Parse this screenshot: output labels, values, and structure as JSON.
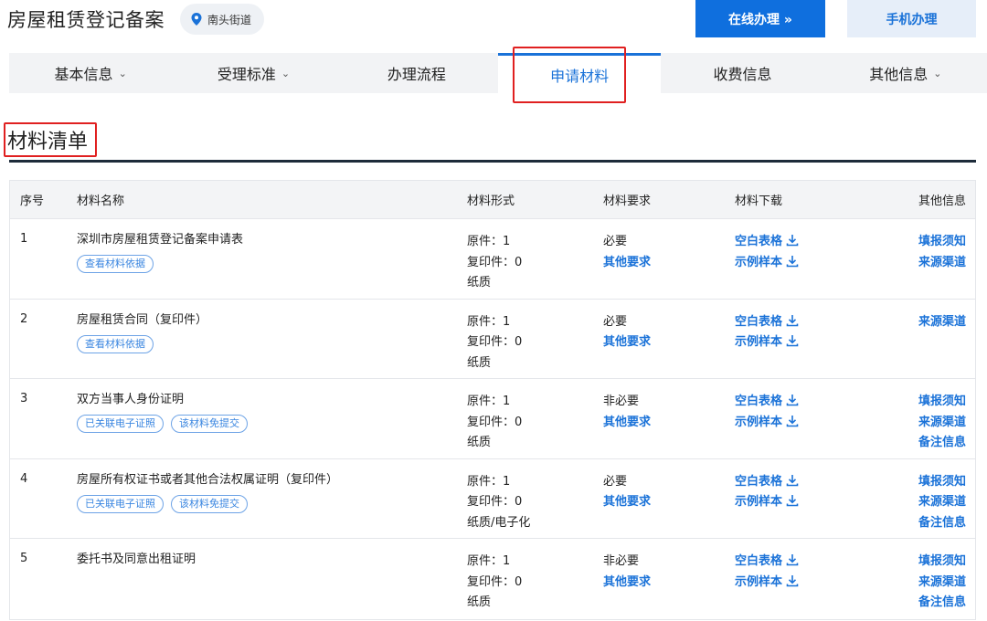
{
  "header": {
    "title": "房屋租赁登记备案",
    "location": "南头街道",
    "online_btn": "在线办理 »",
    "mobile_btn": "手机办理"
  },
  "tabs": [
    {
      "label": "基本信息",
      "dropdown": true
    },
    {
      "label": "受理标准",
      "dropdown": true
    },
    {
      "label": "办理流程",
      "dropdown": false
    },
    {
      "label": "申请材料",
      "dropdown": false,
      "active": true
    },
    {
      "label": "收费信息",
      "dropdown": false
    },
    {
      "label": "其他信息",
      "dropdown": true
    }
  ],
  "section": {
    "title": "材料清单"
  },
  "table": {
    "headers": {
      "idx": "序号",
      "name": "材料名称",
      "form": "材料形式",
      "req": "材料要求",
      "download": "材料下载",
      "other": "其他信息"
    },
    "rows": [
      {
        "idx": "1",
        "name": "深圳市房屋租赁登记备案申请表",
        "tags": [
          "查看材料依据"
        ],
        "form": [
          "原件：1",
          "复印件：0",
          "纸质"
        ],
        "req": "必要",
        "req_link": "其他要求",
        "downloads": [
          "空白表格",
          "示例样本"
        ],
        "other": [
          "填报须知",
          "来源渠道"
        ]
      },
      {
        "idx": "2",
        "name": "房屋租赁合同（复印件）",
        "tags": [
          "查看材料依据"
        ],
        "form": [
          "原件：1",
          "复印件：0",
          "纸质"
        ],
        "req": "必要",
        "req_link": "其他要求",
        "downloads": [
          "空白表格",
          "示例样本"
        ],
        "other": [
          "来源渠道"
        ]
      },
      {
        "idx": "3",
        "name": "双方当事人身份证明",
        "tags": [
          "已关联电子证照",
          "该材料免提交"
        ],
        "form": [
          "原件：1",
          "复印件：0",
          "纸质"
        ],
        "req": "非必要",
        "req_link": "其他要求",
        "downloads": [
          "空白表格",
          "示例样本"
        ],
        "other": [
          "填报须知",
          "来源渠道",
          "备注信息"
        ]
      },
      {
        "idx": "4",
        "name": "房屋所有权证书或者其他合法权属证明（复印件）",
        "tags": [
          "已关联电子证照",
          "该材料免提交"
        ],
        "form": [
          "原件：1",
          "复印件：0",
          "纸质/电子化"
        ],
        "req": "必要",
        "req_link": "其他要求",
        "downloads": [
          "空白表格",
          "示例样本"
        ],
        "other": [
          "填报须知",
          "来源渠道",
          "备注信息"
        ]
      },
      {
        "idx": "5",
        "name": "委托书及同意出租证明",
        "tags": [],
        "form": [
          "原件：1",
          "复印件：0",
          "纸质"
        ],
        "req": "非必要",
        "req_link": "其他要求",
        "downloads": [
          "空白表格",
          "示例样本"
        ],
        "other": [
          "填报须知",
          "来源渠道",
          "备注信息"
        ]
      }
    ]
  },
  "colors": {
    "accent": "#1a72d8",
    "highlight": "#e02020",
    "primary_btn": "#0f6fde"
  },
  "icons": {
    "location": "map-pin-icon",
    "download": "download-icon",
    "chevron": "chevron-down-icon"
  }
}
